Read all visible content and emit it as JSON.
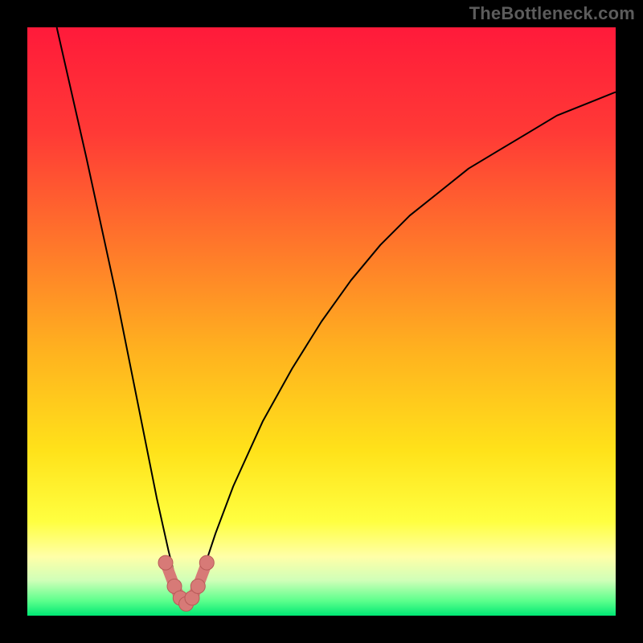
{
  "watermark": "TheBottleneck.com",
  "colors": {
    "frame_bg": "#000000",
    "gradient_stops": [
      {
        "offset": 0.0,
        "color": "#ff1a3a"
      },
      {
        "offset": 0.18,
        "color": "#ff3a36"
      },
      {
        "offset": 0.38,
        "color": "#ff7a2a"
      },
      {
        "offset": 0.55,
        "color": "#ffb21f"
      },
      {
        "offset": 0.72,
        "color": "#ffe21a"
      },
      {
        "offset": 0.84,
        "color": "#ffff40"
      },
      {
        "offset": 0.9,
        "color": "#ffffa8"
      },
      {
        "offset": 0.94,
        "color": "#d0ffb8"
      },
      {
        "offset": 0.975,
        "color": "#5cff8c"
      },
      {
        "offset": 1.0,
        "color": "#00e874"
      }
    ],
    "curve": "#000000",
    "marker_fill": "#d77a77",
    "marker_stroke": "#b85a58"
  },
  "chart_data": {
    "type": "line",
    "title": "",
    "xlabel": "",
    "ylabel": "",
    "xlim": [
      0,
      100
    ],
    "ylim": [
      0,
      100
    ],
    "x_min_at": 27,
    "series": [
      {
        "name": "bottleneck-curve",
        "x": [
          5,
          10,
          15,
          20,
          22,
          24,
          25,
          26,
          27,
          28,
          29,
          30,
          32,
          35,
          40,
          45,
          50,
          55,
          60,
          65,
          70,
          75,
          80,
          85,
          90,
          95,
          100
        ],
        "values": [
          100,
          78,
          55,
          30,
          20,
          11,
          7,
          4,
          2,
          3,
          5,
          8,
          14,
          22,
          33,
          42,
          50,
          57,
          63,
          68,
          72,
          76,
          79,
          82,
          85,
          87,
          89
        ]
      }
    ],
    "markers": {
      "name": "highlighted-points",
      "x": [
        23.5,
        25,
        26,
        27,
        28,
        29,
        30.5
      ],
      "values": [
        9,
        5,
        3,
        2,
        3,
        5,
        9
      ]
    }
  }
}
